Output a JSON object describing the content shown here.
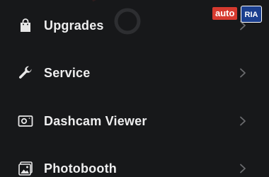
{
  "menu": {
    "items": [
      {
        "label": "Upgrades",
        "icon": "shopping-bag-icon"
      },
      {
        "label": "Service",
        "icon": "wrench-icon"
      },
      {
        "label": "Dashcam Viewer",
        "icon": "dashcam-icon"
      },
      {
        "label": "Photobooth",
        "icon": "photo-icon"
      }
    ]
  },
  "watermark": {
    "part1": "auto",
    "part2": "RIA"
  },
  "colors": {
    "background": "#17181a",
    "text": "#eeeeef",
    "icon": "#e6e6e6",
    "chevron": "#6a6b6e"
  }
}
